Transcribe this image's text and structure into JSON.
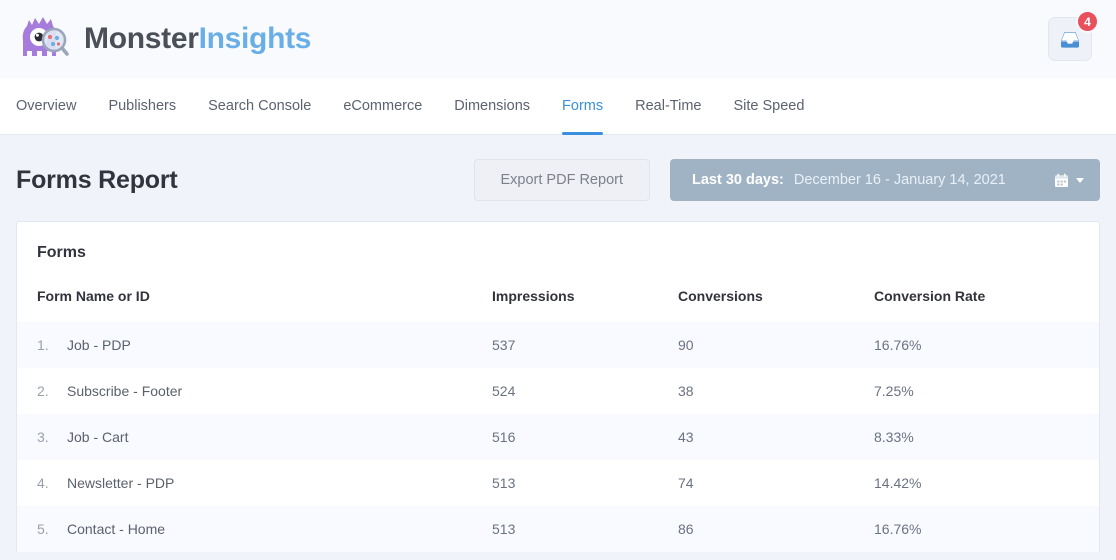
{
  "brand": {
    "name_part1": "Monster",
    "name_part2": "Insights",
    "logo_icon": "monster-magnifier-icon"
  },
  "header": {
    "notifications_icon": "inbox-icon",
    "notifications_count": "4"
  },
  "nav": {
    "tabs": [
      {
        "label": "Overview",
        "active": false
      },
      {
        "label": "Publishers",
        "active": false
      },
      {
        "label": "Search Console",
        "active": false
      },
      {
        "label": "eCommerce",
        "active": false
      },
      {
        "label": "Dimensions",
        "active": false
      },
      {
        "label": "Forms",
        "active": true
      },
      {
        "label": "Real-Time",
        "active": false
      },
      {
        "label": "Site Speed",
        "active": false
      }
    ]
  },
  "report": {
    "title": "Forms Report",
    "export_button": "Export PDF Report",
    "daterange": {
      "label": "Last 30 days:",
      "value": "December 16 - January 14, 2021",
      "calendar_icon": "calendar-icon",
      "caret_icon": "chevron-down-icon"
    }
  },
  "table": {
    "card_title": "Forms",
    "columns": [
      "Form Name or ID",
      "Impressions",
      "Conversions",
      "Conversion Rate"
    ],
    "rows": [
      {
        "num": "1.",
        "name": "Job - PDP",
        "impressions": "537",
        "conversions": "90",
        "rate": "16.76%"
      },
      {
        "num": "2.",
        "name": "Subscribe - Footer",
        "impressions": "524",
        "conversions": "38",
        "rate": "7.25%"
      },
      {
        "num": "3.",
        "name": "Job - Cart",
        "impressions": "516",
        "conversions": "43",
        "rate": "8.33%"
      },
      {
        "num": "4.",
        "name": "Newsletter - PDP",
        "impressions": "513",
        "conversions": "74",
        "rate": "14.42%"
      },
      {
        "num": "5.",
        "name": "Contact - Home",
        "impressions": "513",
        "conversions": "86",
        "rate": "16.76%"
      }
    ]
  },
  "colors": {
    "accent_blue": "#3a8fde",
    "badge_red": "#e8505b",
    "daterange_bg": "#9fb3c5",
    "page_bg": "#f1f3fa",
    "monster_purple": "#a77bdc"
  }
}
